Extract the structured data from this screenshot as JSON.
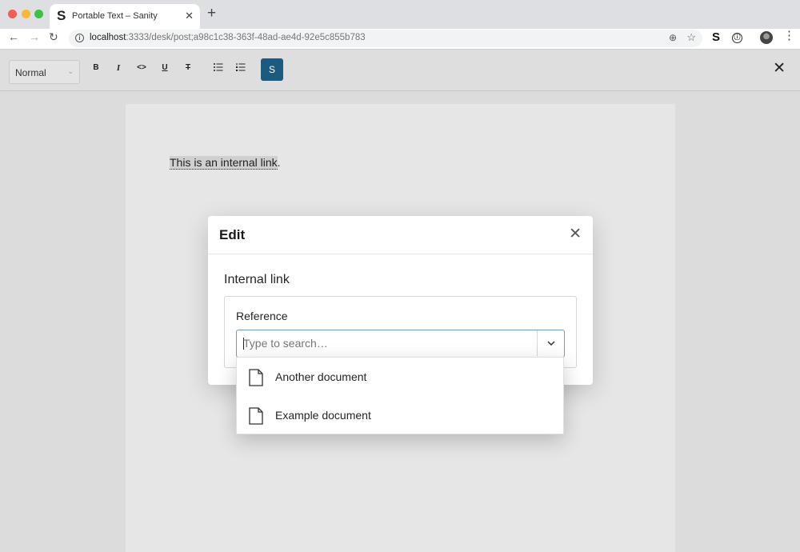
{
  "browser": {
    "tab_title": "Portable Text – Sanity",
    "tab_favicon": "S",
    "url_host": "localhost",
    "url_rest": ":3333/desk/post;a98c1c38-363f-48ad-ae4d-92e5c855b783",
    "extension_label": "S"
  },
  "toolbar": {
    "style_value": "Normal",
    "buttons": {
      "bold": "B",
      "italic": "I",
      "code": "<>",
      "underline": "U",
      "strike": "T"
    },
    "sanity_button": "S"
  },
  "document": {
    "link_text": "This is an internal link",
    "after_link": "."
  },
  "dialog": {
    "title": "Edit",
    "section_title": "Internal link",
    "field_label": "Reference",
    "search_placeholder": "Type to search…"
  },
  "dropdown": {
    "items": [
      {
        "label": "Another document",
        "icon": "document-icon"
      },
      {
        "label": "Example document",
        "icon": "document-icon"
      }
    ]
  },
  "icons": {
    "back": "arrow-left-icon",
    "forward": "arrow-right-icon",
    "reload": "reload-icon",
    "close": "close-icon",
    "chevron": "chevron-down-icon"
  },
  "colors": {
    "accent": "#1d5a80",
    "focus_border": "#6a9ec4"
  }
}
